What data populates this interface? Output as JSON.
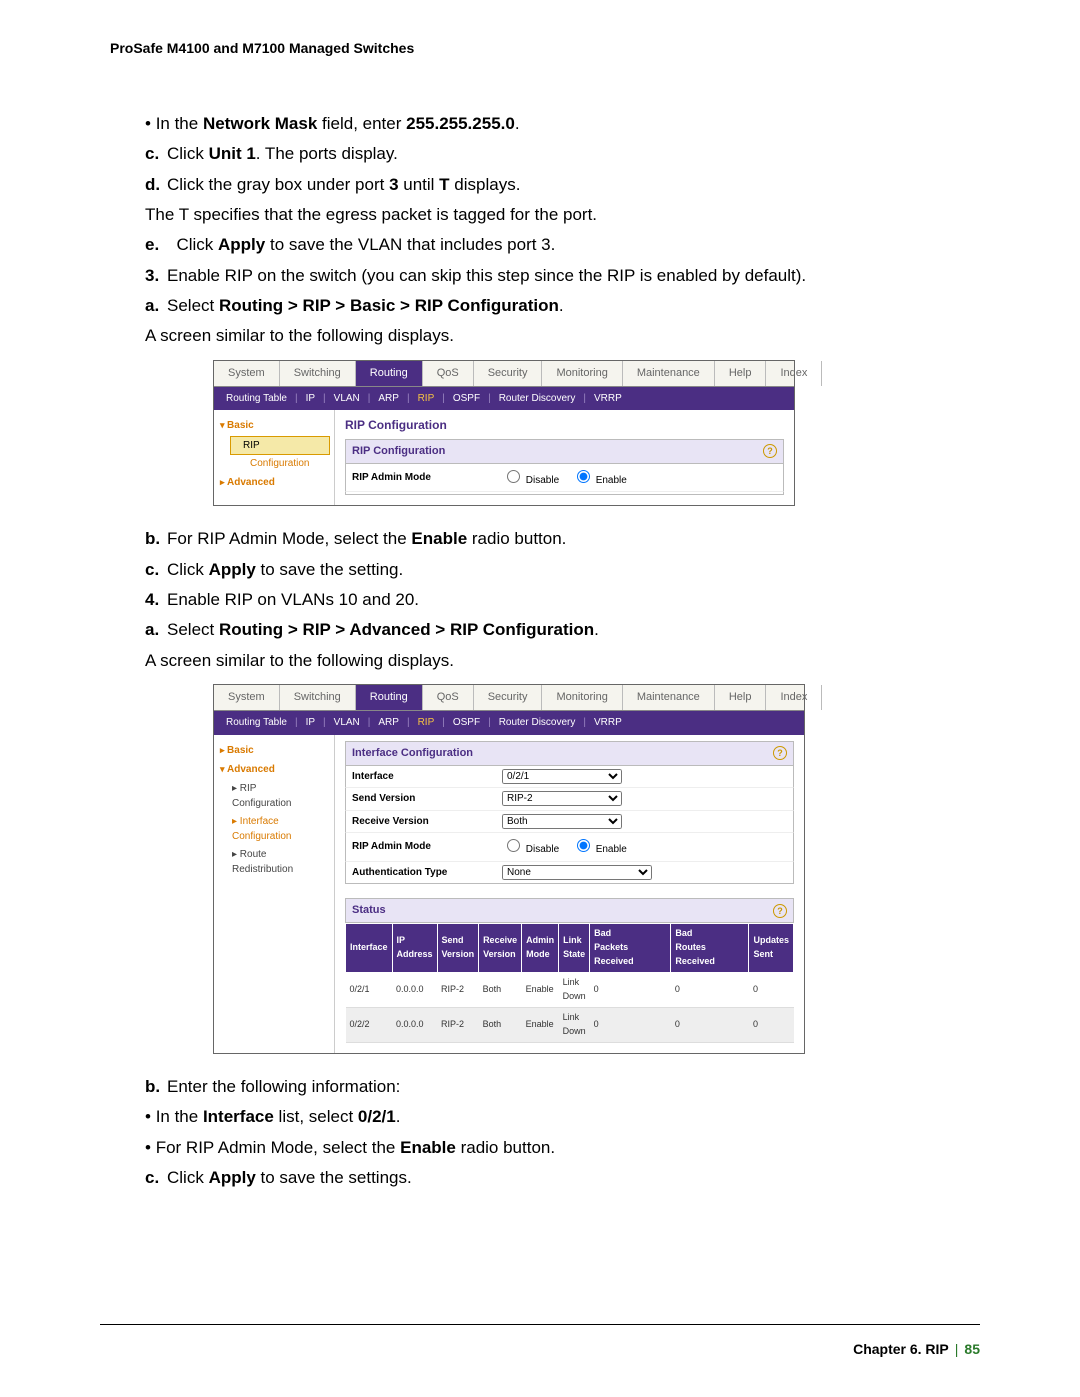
{
  "doc_header": "ProSafe M4100 and M7100 Managed Switches",
  "lines": {
    "bullet1_pre": "In the ",
    "bullet1_b1": "Network Mask",
    "bullet1_mid": " field, enter ",
    "bullet1_b2": "255.255.255.0",
    "bullet1_post": ".",
    "c_pre": "Click ",
    "c_b": "Unit 1",
    "c_post": ". The ports display.",
    "d_pre": "Click the gray box under port ",
    "d_b1": "3",
    "d_mid": " until ",
    "d_b2": "T",
    "d_post": " displays.",
    "d_extra": "The T specifies that the egress packet is tagged for the port.",
    "e_pre": "Click ",
    "e_b": "Apply",
    "e_post": " to save the VLAN that includes port 3.",
    "n3": "Enable RIP on the switch (you can skip this step since the RIP is enabled by default).",
    "n3a_pre": "Select ",
    "n3a_b": "Routing > RIP > Basic > RIP Configuration",
    "n3a_post": ".",
    "similar": "A screen similar to the following displays.",
    "n3b_pre": "For RIP Admin Mode, select the ",
    "n3b_b": "Enable",
    "n3b_post": " radio button.",
    "n3c_pre": "Click ",
    "n3c_b": "Apply",
    "n3c_post": " to save the setting.",
    "n4": "Enable RIP on VLANs 10 and 20.",
    "n4a_pre": "Select ",
    "n4a_b": "Routing > RIP > Advanced > RIP Configuration",
    "n4a_post": ".",
    "n4b": "Enter the following information:",
    "n4b_bul1_pre": "In the ",
    "n4b_bul1_b1": "Interface",
    "n4b_bul1_mid": " list, select ",
    "n4b_bul1_b2": "0/2/1",
    "n4b_bul1_post": ".",
    "n4b_bul2_pre": "For RIP Admin Mode, select the ",
    "n4b_bul2_b": "Enable",
    "n4b_bul2_post": " radio button.",
    "n4c_pre": "Click ",
    "n4c_b": "Apply",
    "n4c_post": " to save the settings."
  },
  "shot1": {
    "tabs": [
      "System",
      "Switching",
      "Routing",
      "QoS",
      "Security",
      "Monitoring",
      "Maintenance",
      "Help",
      "Index"
    ],
    "active_tab": "Routing",
    "subnav": [
      "Routing Table",
      "IP",
      "VLAN",
      "ARP",
      "RIP",
      "OSPF",
      "Router Discovery",
      "VRRP"
    ],
    "subnav_hl": "RIP",
    "sidebar": {
      "basic": "Basic",
      "rip_item": "RIP",
      "config_item": "Configuration",
      "advanced": "Advanced"
    },
    "title": "RIP Configuration",
    "box_head": "RIP Configuration",
    "row_label": "RIP Admin Mode",
    "disable": "Disable",
    "enable": "Enable"
  },
  "shot2": {
    "tabs": [
      "System",
      "Switching",
      "Routing",
      "QoS",
      "Security",
      "Monitoring",
      "Maintenance",
      "Help",
      "Index"
    ],
    "active_tab": "Routing",
    "subnav": [
      "Routing Table",
      "IP",
      "VLAN",
      "ARP",
      "RIP",
      "OSPF",
      "Router Discovery",
      "VRRP"
    ],
    "subnav_hl": "RIP",
    "sidebar": {
      "basic": "Basic",
      "advanced": "Advanced",
      "items": [
        "RIP Configuration",
        "Interface Configuration",
        "Route Redistribution"
      ],
      "selected": "Interface Configuration"
    },
    "title": "Interface Configuration",
    "form": {
      "interface_lbl": "Interface",
      "interface_val": "0/2/1",
      "send_lbl": "Send Version",
      "send_val": "RIP-2",
      "recv_lbl": "Receive Version",
      "recv_val": "Both",
      "admin_lbl": "RIP Admin Mode",
      "disable": "Disable",
      "enable": "Enable",
      "auth_lbl": "Authentication Type",
      "auth_val": "None"
    },
    "status_title": "Status",
    "status_head": [
      "Interface",
      "IP Address",
      "Send Version",
      "Receive Version",
      "Admin Mode",
      "Link State",
      "Bad Packets Received",
      "Bad Routes Received",
      "Updates Sent"
    ],
    "status_rows": [
      [
        "0/2/1",
        "0.0.0.0",
        "RIP-2",
        "Both",
        "Enable",
        "Link Down",
        "0",
        "0",
        "0"
      ],
      [
        "0/2/2",
        "0.0.0.0",
        "RIP-2",
        "Both",
        "Enable",
        "Link Down",
        "0",
        "0",
        "0"
      ]
    ]
  },
  "footer": {
    "chapter": "Chapter 6.  RIP",
    "page": "85"
  }
}
